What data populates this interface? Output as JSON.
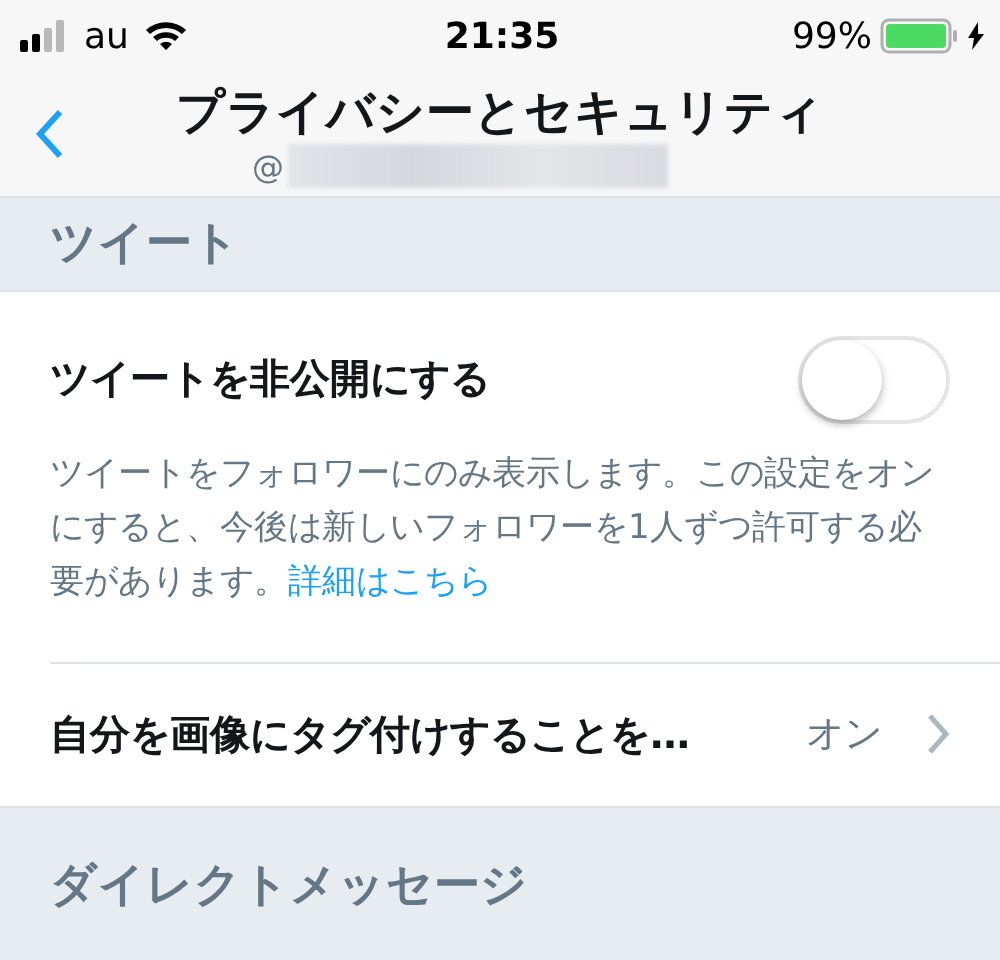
{
  "status_bar": {
    "carrier": "au",
    "time": "21:35",
    "battery": "99%",
    "charging": true
  },
  "header": {
    "title": "プライバシーとセキュリティ",
    "handle_prefix": "@",
    "handle_redacted": true
  },
  "sections": [
    {
      "title": "ツイート",
      "rows": [
        {
          "kind": "toggle",
          "label": "ツイートを非公開にする",
          "on": false,
          "description": "ツイートをフォロワーにのみ表示します。この設定をオンにすると、今後は新しいフォロワーを1人ずつ許可する必要があります。",
          "link": "詳細はこちら"
        },
        {
          "kind": "link",
          "label": "自分を画像にタグ付けすることを…",
          "value": "オン"
        }
      ]
    },
    {
      "title": "ダイレクトメッセージ"
    }
  ]
}
